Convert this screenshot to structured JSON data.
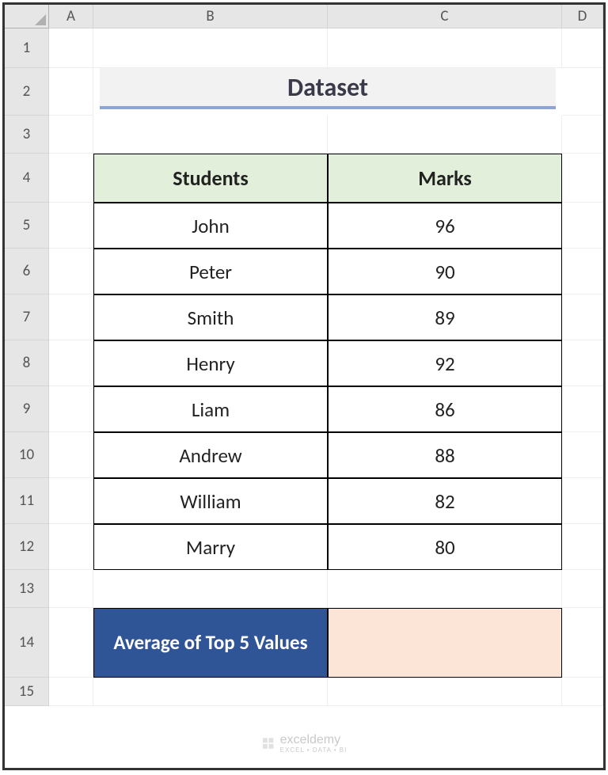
{
  "columns": [
    "",
    "A",
    "B",
    "C",
    "D"
  ],
  "rows": [
    "1",
    "2",
    "3",
    "4",
    "5",
    "6",
    "7",
    "8",
    "9",
    "10",
    "11",
    "12",
    "13",
    "14",
    "15"
  ],
  "title": "Dataset",
  "table": {
    "headers": {
      "col1": "Students",
      "col2": "Marks"
    },
    "data": [
      {
        "student": "John",
        "marks": "96"
      },
      {
        "student": "Peter",
        "marks": "90"
      },
      {
        "student": "Smith",
        "marks": "89"
      },
      {
        "student": "Henry",
        "marks": "92"
      },
      {
        "student": "Liam",
        "marks": "86"
      },
      {
        "student": "Andrew",
        "marks": "88"
      },
      {
        "student": "William",
        "marks": "82"
      },
      {
        "student": "Marry",
        "marks": "80"
      }
    ]
  },
  "average": {
    "label": "Average of Top 5 Values",
    "value": ""
  },
  "watermark": {
    "brand": "exceldemy",
    "tag": "EXCEL • DATA • BI"
  }
}
